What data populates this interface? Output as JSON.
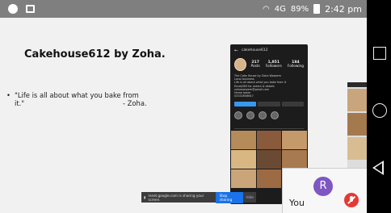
{
  "status_bar": {
    "signal_text": "4G",
    "battery_text": "89%",
    "time": "2:42 pm",
    "icons": [
      "message-icon",
      "gallery-icon",
      "hotspot-icon",
      "signal-icon",
      "battery-icon"
    ]
  },
  "slide": {
    "title": "Cakehouse612 by Zoha.",
    "bullet_symbol": "•",
    "quote_line1": "\"Life is all about what you bake from",
    "quote_line2": "it.\"",
    "quote_author": "- Zoha."
  },
  "phone_screenshot": {
    "username": "cakehouse612",
    "posts_count": "217",
    "posts_label": "Posts",
    "followers_count": "1,851",
    "followers_label": "Followers",
    "following_count": "184",
    "following_label": "Following",
    "bio_lines": [
      "The Cake House by Zoha Waseem",
      "Local business",
      "Life is all about what you bake from it",
      "Email/DM for orders & details",
      "zohawaseem@gmail.com",
      "Home baker",
      "03332656647"
    ],
    "grid_colors": [
      "#b58b5a",
      "#8a5a3c",
      "#c59a6a",
      "#d9b783",
      "#6b4a33",
      "#a87a4f",
      "#caa57a",
      "#9c6b44",
      "#e0c290"
    ]
  },
  "share_banner": {
    "message": "meet.google.com is sharing your screen.",
    "stop_label": "Stop sharing",
    "hide_label": "Hide"
  },
  "participant": {
    "initial": "R",
    "label": "You",
    "avatar_color": "#7e57c2",
    "mic_state_color": "#e53935"
  },
  "nav_bar": {
    "buttons": [
      "recents",
      "home",
      "back"
    ]
  }
}
